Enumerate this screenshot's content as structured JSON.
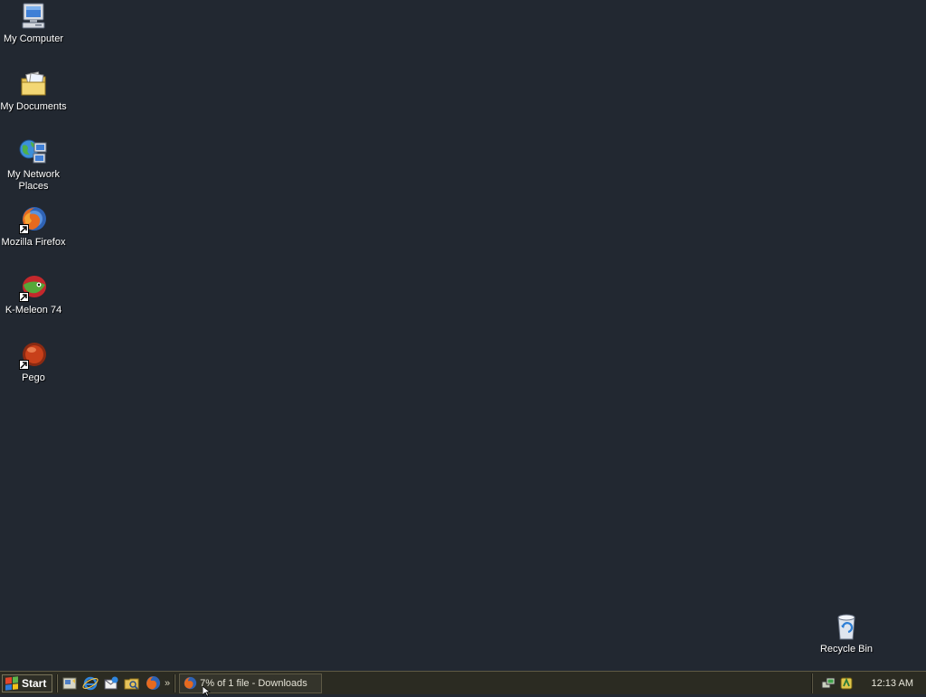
{
  "desktop": {
    "icons": [
      {
        "label": "My Computer",
        "icon": "my-computer-icon",
        "shortcut": false
      },
      {
        "label": "My Documents",
        "icon": "my-documents-icon",
        "shortcut": false
      },
      {
        "label": "My Network Places",
        "icon": "my-network-places-icon",
        "shortcut": false
      },
      {
        "label": "Mozilla Firefox",
        "icon": "firefox-icon",
        "shortcut": true
      },
      {
        "label": "K-Meleon 74",
        "icon": "k-meleon-icon",
        "shortcut": true
      },
      {
        "label": "Pego",
        "icon": "pego-icon",
        "shortcut": true
      }
    ],
    "recycle_bin": {
      "label": "Recycle Bin",
      "icon": "recycle-bin-icon"
    }
  },
  "taskbar": {
    "start_label": "Start",
    "quick_launch": [
      "show-desktop-icon",
      "internet-explorer-icon",
      "outlook-express-icon",
      "windows-explorer-icon",
      "firefox-icon"
    ],
    "overflow_label": "»",
    "tasks": [
      {
        "label": "7% of 1 file - Downloads",
        "icon": "firefox-icon"
      }
    ],
    "tray_icons": [
      "network-icon",
      "tray-app-icon"
    ],
    "clock": "12:13 AM"
  },
  "colors": {
    "desktop_background": "#222831",
    "taskbar_background": "#2b2b22",
    "text": "#ffffff"
  }
}
